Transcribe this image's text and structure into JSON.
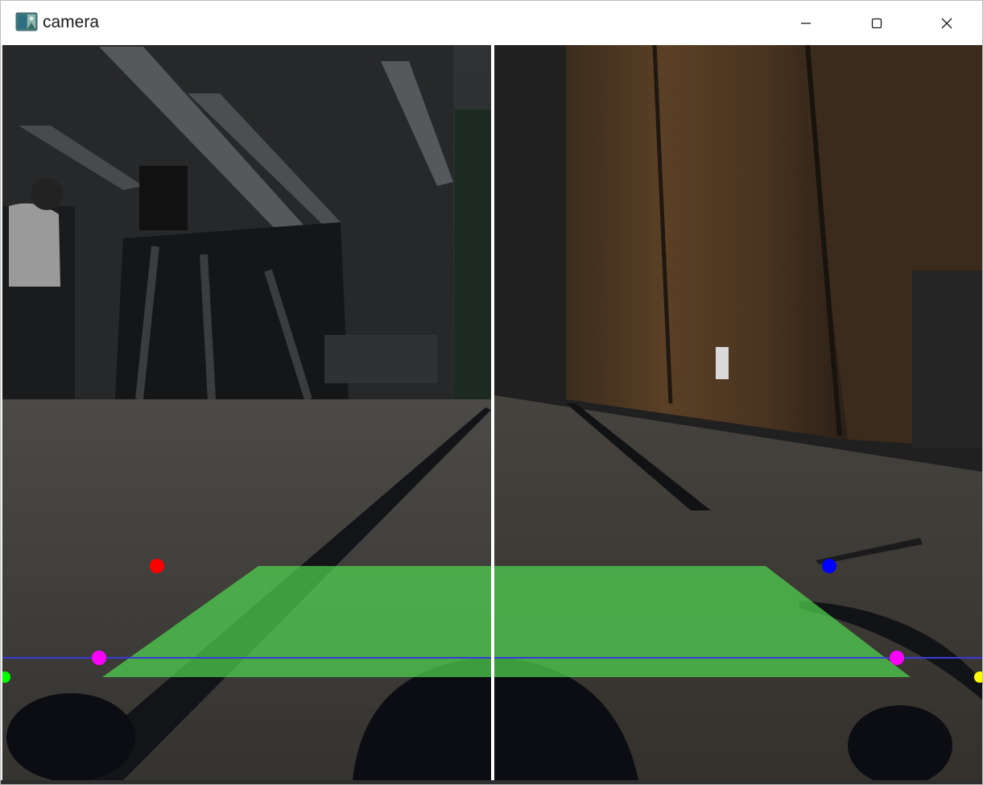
{
  "window": {
    "title": "camera",
    "icon": "image-app-icon",
    "controls": {
      "minimize": "minimize-icon",
      "maximize": "maximize-icon",
      "close": "close-icon"
    }
  },
  "colors": {
    "floor_overlay": "#4fd44f",
    "horizon_line": "#3b3bd6",
    "left_lane_point": "#ff0000",
    "right_lane_point": "#0000ff",
    "horizon_points": "#ff00ff",
    "edge_point_left": "#00ff00",
    "edge_point_right": "#ffff00",
    "divider": "#ffffff"
  }
}
